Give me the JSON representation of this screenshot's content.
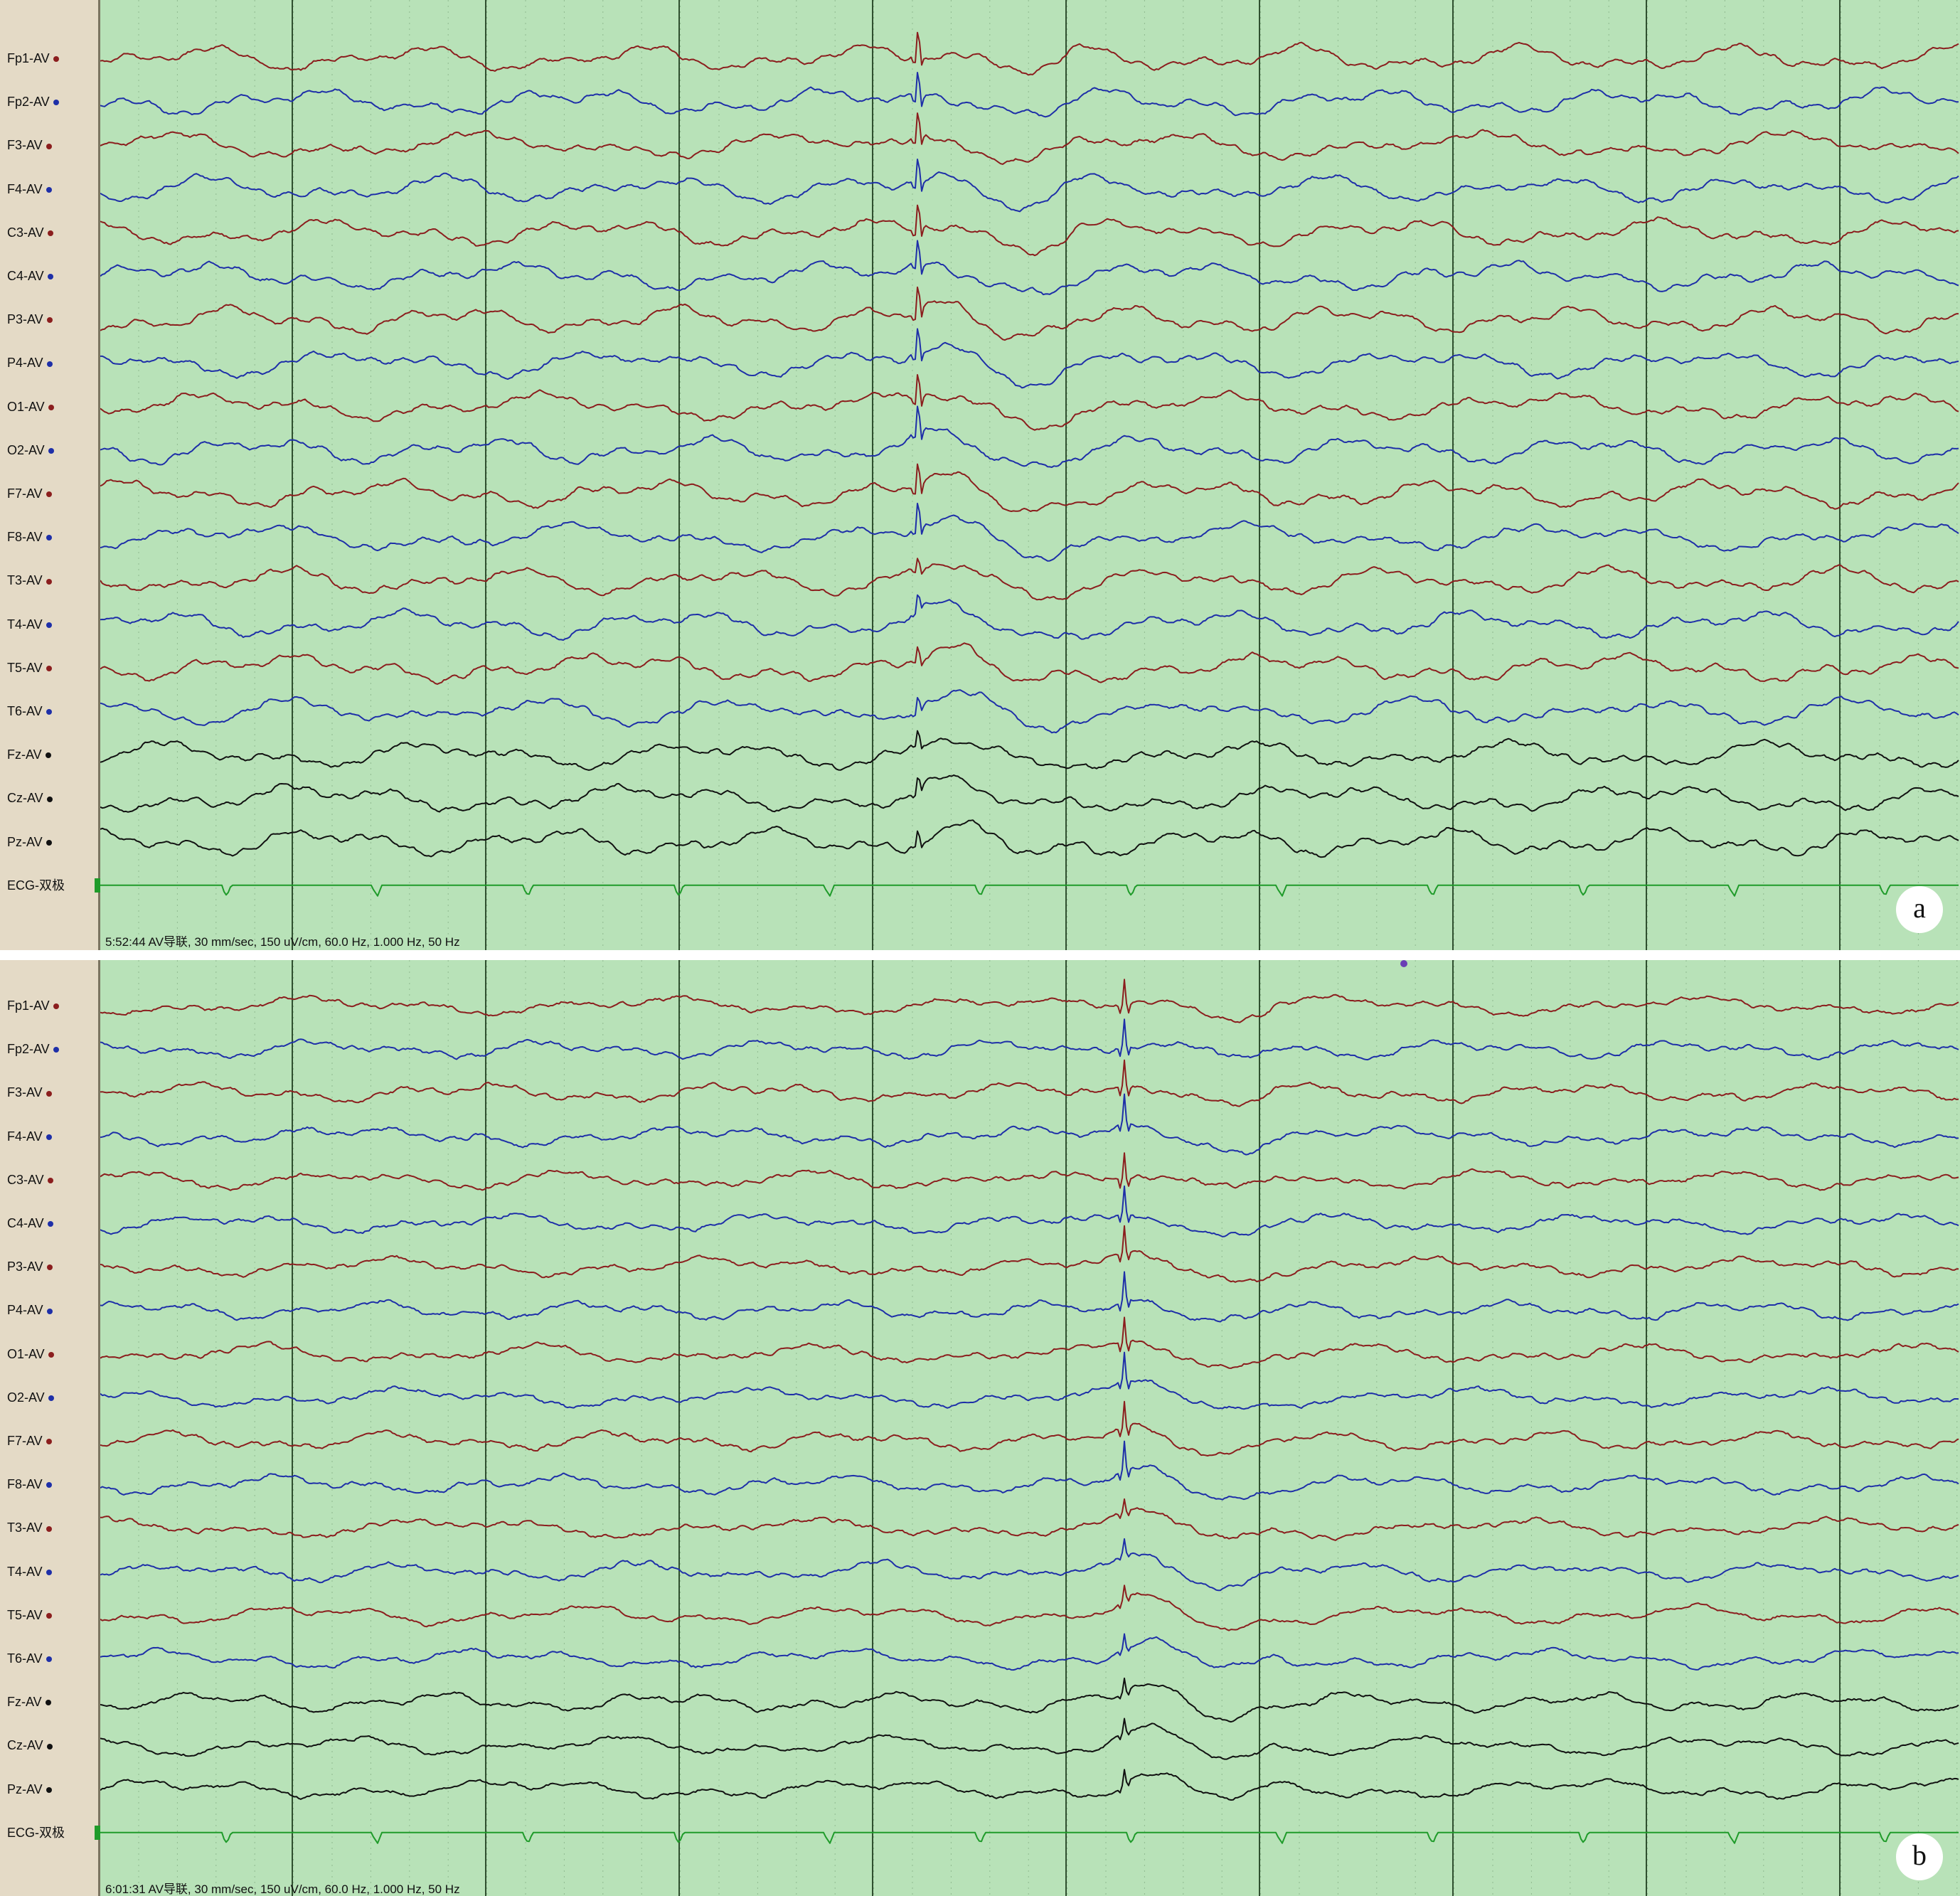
{
  "colors": {
    "background": "#b8e2b8",
    "label_column": "#e4dac6",
    "red_trace": "#8b1e1e",
    "blue_trace": "#1e2fa8",
    "black_trace": "#111111",
    "ecg_trace": "#1f9b2a",
    "gridline": "#2f4f2f"
  },
  "channels": [
    {
      "label": "Fp1-AV",
      "color": "red"
    },
    {
      "label": "Fp2-AV",
      "color": "blue"
    },
    {
      "label": "F3-AV",
      "color": "red"
    },
    {
      "label": "F4-AV",
      "color": "blue"
    },
    {
      "label": "C3-AV",
      "color": "red"
    },
    {
      "label": "C4-AV",
      "color": "blue"
    },
    {
      "label": "P3-AV",
      "color": "red"
    },
    {
      "label": "P4-AV",
      "color": "blue"
    },
    {
      "label": "O1-AV",
      "color": "red"
    },
    {
      "label": "O2-AV",
      "color": "blue"
    },
    {
      "label": "F7-AV",
      "color": "red"
    },
    {
      "label": "F8-AV",
      "color": "blue"
    },
    {
      "label": "T3-AV",
      "color": "red"
    },
    {
      "label": "T4-AV",
      "color": "blue"
    },
    {
      "label": "T5-AV",
      "color": "red"
    },
    {
      "label": "T6-AV",
      "color": "blue"
    },
    {
      "label": "Fz-AV",
      "color": "black"
    },
    {
      "label": "Cz-AV",
      "color": "black"
    },
    {
      "label": "Pz-AV",
      "color": "black"
    },
    {
      "label": "ECG-双极",
      "color": "ecg"
    }
  ],
  "panels": {
    "a": {
      "badge": "a",
      "status": "5:52:44 AV导联, 30 mm/sec, 150 uV/cm, 60.0 Hz, 1.000 Hz, 50 Hz"
    },
    "b": {
      "badge": "b",
      "status": "6:01:31 AV导联, 30 mm/sec, 150 uV/cm, 60.0 Hz, 1.000 Hz, 50 Hz"
    }
  }
}
